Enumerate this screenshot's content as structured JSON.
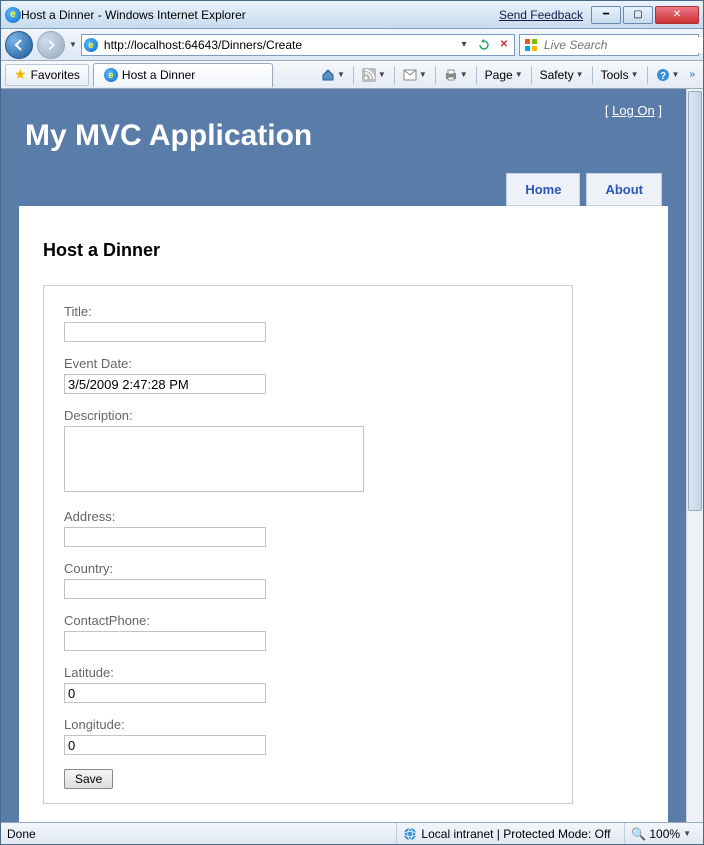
{
  "window": {
    "title": "Host a Dinner - Windows Internet Explorer",
    "feedback": "Send Feedback"
  },
  "nav": {
    "url": "http://localhost:64643/Dinners/Create",
    "search_placeholder": "Live Search"
  },
  "favbar": {
    "favorites": "Favorites",
    "tab_title": "Host a Dinner"
  },
  "toolbar": {
    "page": "Page",
    "safety": "Safety",
    "tools": "Tools"
  },
  "app": {
    "title": "My MVC Application",
    "logon_prefix": "[ ",
    "logon": "Log On",
    "logon_suffix": " ]",
    "tabs": {
      "home": "Home",
      "about": "About"
    }
  },
  "page": {
    "heading": "Host a Dinner",
    "fields": {
      "title": {
        "label": "Title:",
        "value": ""
      },
      "eventdate": {
        "label": "Event Date:",
        "value": "3/5/2009 2:47:28 PM"
      },
      "description": {
        "label": "Description:",
        "value": ""
      },
      "address": {
        "label": "Address:",
        "value": ""
      },
      "country": {
        "label": "Country:",
        "value": ""
      },
      "contactphone": {
        "label": "ContactPhone:",
        "value": ""
      },
      "latitude": {
        "label": "Latitude:",
        "value": "0"
      },
      "longitude": {
        "label": "Longitude:",
        "value": "0"
      }
    },
    "save": "Save"
  },
  "status": {
    "done": "Done",
    "zone": "Local intranet | Protected Mode: Off",
    "zoom": "100%"
  }
}
